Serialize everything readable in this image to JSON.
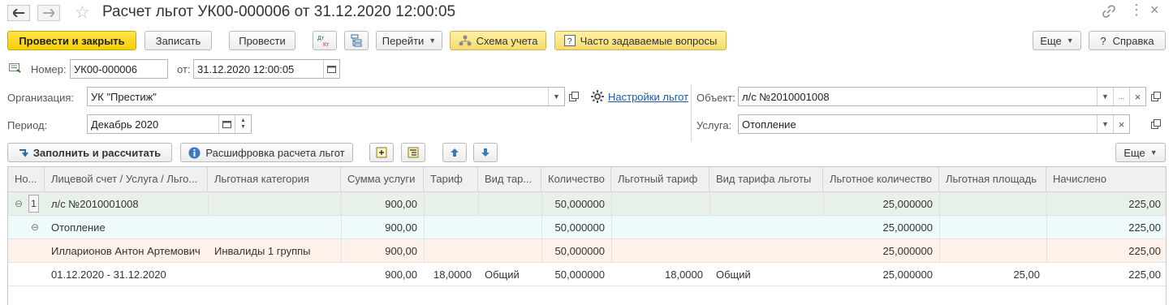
{
  "window": {
    "title": "Расчет льгот УК00-000006 от 31.12.2020 12:00:05"
  },
  "toolbar": {
    "post_close": "Провести и закрыть",
    "save": "Записать",
    "post": "Провести",
    "dt_kt": "Дт Кт",
    "goto": "Перейти",
    "scheme": "Схема учета",
    "faq": "Часто задаваемые вопросы",
    "more": "Еще",
    "help": "Справка"
  },
  "header": {
    "number_label": "Номер:",
    "number_value": "УК00-000006",
    "date_label": "от:",
    "date_value": "31.12.2020 12:00:05",
    "org_label": "Организация:",
    "org_value": "УК \"Престиж\"",
    "settings_link": "Настройки льгот",
    "object_label": "Объект:",
    "object_value": "л/с №2010001008",
    "period_label": "Период:",
    "period_value": "Декабрь 2020",
    "service_label": "Услуга:",
    "service_value": "Отопление"
  },
  "table_toolbar": {
    "fill_calc": "Заполнить и рассчитать",
    "decode": "Расшифровка расчета льгот",
    "more": "Еще"
  },
  "table": {
    "columns": [
      "Но...",
      "Лицевой счет / Услуга / Льго...",
      "Льготная категория",
      "Сумма услуги",
      "Тариф",
      "Вид тар...",
      "Количество",
      "Льготный тариф",
      "Вид тарифа льготы",
      "Льготное количество",
      "Льготная площадь",
      "Начислено"
    ],
    "rows": [
      {
        "no": "1",
        "name": "л/с №2010001008",
        "category": "",
        "sum": "900,00",
        "tariff": "",
        "tariff_type": "",
        "qty": "50,000000",
        "ben_tariff": "",
        "ben_tariff_type": "",
        "ben_qty": "25,000000",
        "ben_area": "",
        "accrued": "225,00"
      },
      {
        "no": "",
        "name": "Отопление",
        "category": "",
        "sum": "900,00",
        "tariff": "",
        "tariff_type": "",
        "qty": "50,000000",
        "ben_tariff": "",
        "ben_tariff_type": "",
        "ben_qty": "25,000000",
        "ben_area": "",
        "accrued": "225,00"
      },
      {
        "no": "",
        "name": "Илларионов Антон Артемович",
        "category": "Инвалиды 1 группы",
        "sum": "900,00",
        "tariff": "",
        "tariff_type": "",
        "qty": "50,000000",
        "ben_tariff": "",
        "ben_tariff_type": "",
        "ben_qty": "25,000000",
        "ben_area": "",
        "accrued": "225,00"
      },
      {
        "no": "",
        "name": "01.12.2020 - 31.12.2020",
        "category": "",
        "sum": "900,00",
        "tariff": "18,0000",
        "tariff_type": "Общий",
        "qty": "50,000000",
        "ben_tariff": "18,0000",
        "ben_tariff_type": "Общий",
        "ben_qty": "25,000000",
        "ben_area": "25,00",
        "accrued": "225,00"
      }
    ]
  },
  "colors": {
    "row_account_bg": "#e8f1e8",
    "row_service_bg": "#effafa",
    "row_person_bg": "#fdf1ea",
    "accent_yellow": "#f6cf00"
  }
}
